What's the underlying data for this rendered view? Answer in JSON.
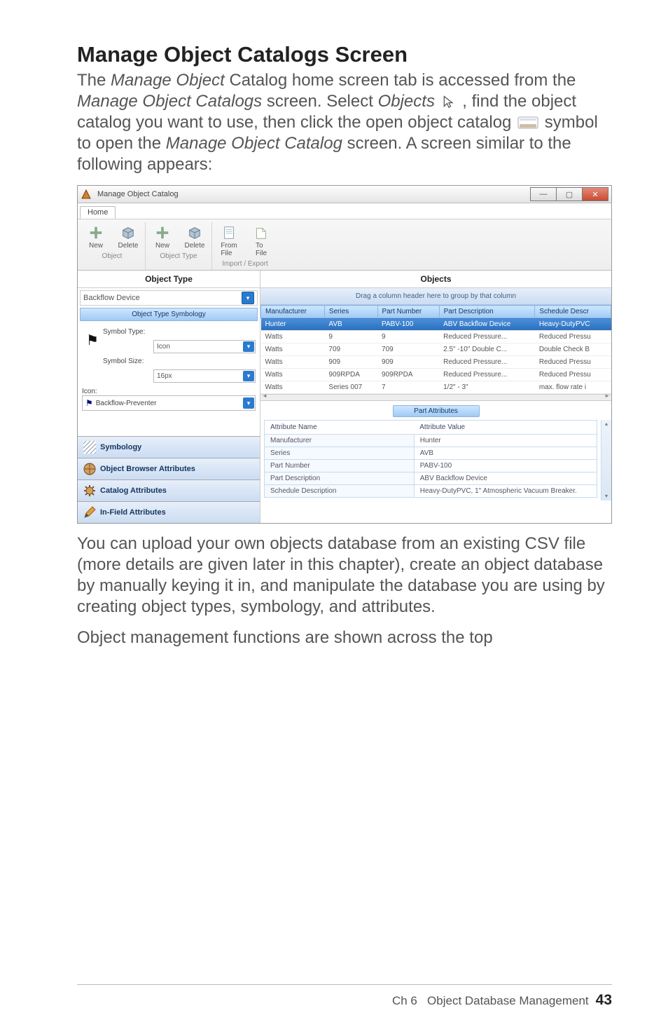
{
  "heading": "Manage Object Catalogs Screen",
  "para1_parts": {
    "a": "The ",
    "b": "Manage Object",
    "c": " Catalog home screen tab is accessed from the ",
    "d": "Manage Object Catalogs",
    "e": " screen. Select ",
    "f": "Objects",
    "g": " , find the object catalog you want to use, then click the open object catalog ",
    "h": " symbol to open the ",
    "i": "Manage Object Catalog",
    "j": " screen. A screen similar to the following appears:"
  },
  "para2": "You can upload your own objects database from an existing CSV file (more details are given later in this chapter), create an object database by manually keying it in, and manipulate the database you are using by creating object types, symbology, and attributes.",
  "para3": "Object management functions are shown across the top",
  "footer": {
    "ch": "Ch 6",
    "title": "Object Database Management",
    "page": "43"
  },
  "shot": {
    "title": "Manage Object Catalog",
    "home": "Home",
    "ribbon": {
      "object": {
        "label": "Object",
        "new": "New",
        "delete": "Delete"
      },
      "objecttype": {
        "label": "Object Type",
        "new": "New",
        "delete": "Delete"
      },
      "impexp": {
        "label": "Import / Export",
        "from": "From\nFile",
        "to": "To\nFile"
      }
    },
    "leftHeader": "Object Type",
    "rightHeader": "Objects",
    "backflow": "Backflow Device",
    "ots": {
      "header": "Object Type Symbology",
      "symbolTypeLbl": "Symbol Type:",
      "symbolTypeVal": "Icon",
      "symbolSizeLbl": "Symbol Size:",
      "symbolSizeVal": "16px",
      "iconLbl": "Icon:",
      "iconVal": "Backflow-Preventer"
    },
    "nav": {
      "symbology": "Symbology",
      "oba": "Object Browser Attributes",
      "catattr": "Catalog Attributes",
      "infield": "In-Field Attributes"
    },
    "hint": "Drag a column header here to group by that column",
    "gridHeaders": [
      "Manufacturer",
      "Series",
      "Part Number",
      "Part Description",
      "Schedule Descr"
    ],
    "gridRows": [
      [
        "Hunter",
        "AVB",
        "PABV-100",
        "ABV Backflow Device",
        "Heavy-DutyPVC"
      ],
      [
        "Watts",
        "9",
        "9",
        "Reduced Pressure...",
        "Reduced Pressu"
      ],
      [
        "Watts",
        "709",
        "709",
        "2.5\" -10\" Double C...",
        "Double Check B"
      ],
      [
        "Watts",
        "909",
        "909",
        "Reduced Pressure...",
        "Reduced Pressu"
      ],
      [
        "Watts",
        "909RPDA",
        "909RPDA",
        "Reduced Pressure...",
        "Reduced Pressu"
      ],
      [
        "Watts",
        "Series 007",
        "7",
        "1/2\" - 3\"",
        "max. flow rate i"
      ]
    ],
    "partAttrHeader": "Part Attributes",
    "attrHeaders": [
      "Attribute Name",
      "Attribute Value"
    ],
    "attrRows": [
      [
        "Manufacturer",
        "Hunter"
      ],
      [
        "Series",
        "AVB"
      ],
      [
        "Part Number",
        "PABV-100"
      ],
      [
        "Part Description",
        "ABV Backflow Device"
      ],
      [
        "Schedule Description",
        "Heavy-DutyPVC, 1\" Atmospheric Vacuum Breaker."
      ]
    ]
  }
}
